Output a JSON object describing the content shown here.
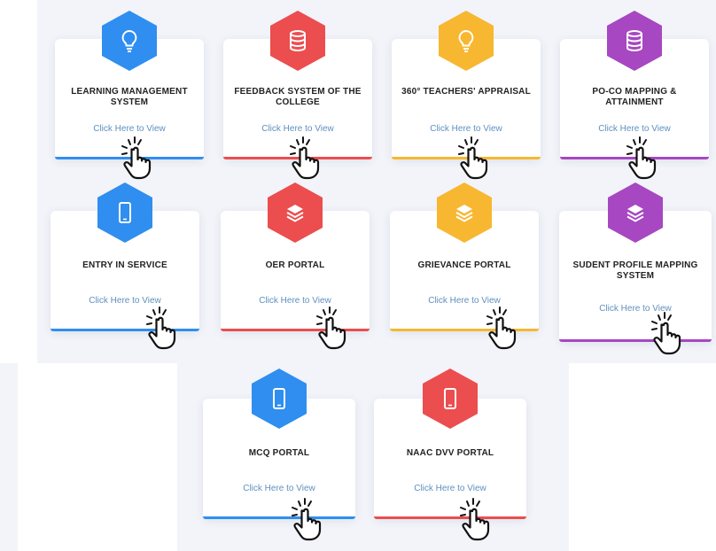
{
  "colors": {
    "blue": "#2f8ef0",
    "red": "#ec4d4f",
    "yellow": "#f7b731",
    "purple": "#a747c2"
  },
  "cards": [
    {
      "title": "LEARNING MANAGEMENT SYSTEM",
      "link": "Click Here to View",
      "color": "blue",
      "icon": "lightbulb-icon"
    },
    {
      "title": "FEEDBACK SYSTEM OF THE COLLEGE",
      "link": "Click Here to View",
      "color": "red",
      "icon": "database-icon"
    },
    {
      "title": "360° TEACHERS' APPRAISAL",
      "link": "Click Here to View",
      "color": "yellow",
      "icon": "lightbulb-icon"
    },
    {
      "title": "PO-CO MAPPING & ATTAINMENT",
      "link": "Click Here to View",
      "color": "purple",
      "icon": "database-icon"
    },
    {
      "title": "ENTRY IN SERVICE",
      "link": "Click Here to View",
      "color": "blue",
      "icon": "mobile-icon"
    },
    {
      "title": "OER PORTAL",
      "link": "Click Here to View",
      "color": "red",
      "icon": "layers-icon"
    },
    {
      "title": "GRIEVANCE PORTAL",
      "link": "Click Here to View",
      "color": "yellow",
      "icon": "layers-icon"
    },
    {
      "title": "SUDENT PROFILE MAPPING SYSTEM",
      "link": "Click Here to View",
      "color": "purple",
      "icon": "layers-icon"
    },
    {
      "title": "MCQ PORTAL",
      "link": "Click Here to View",
      "color": "blue",
      "icon": "mobile-icon"
    },
    {
      "title": "NAAC DVV PORTAL",
      "link": "Click Here to View",
      "color": "red",
      "icon": "mobile-icon"
    }
  ]
}
